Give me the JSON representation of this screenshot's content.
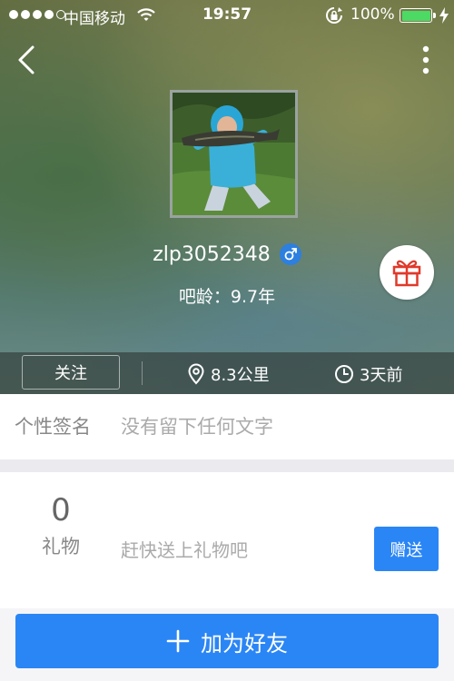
{
  "status_bar": {
    "carrier": "中国移动",
    "time": "19:57",
    "battery": "100%"
  },
  "profile": {
    "username": "zlp3052348",
    "gender_icon": "male-icon",
    "bar_age": "吧龄：9.7年"
  },
  "stats": {
    "follow_label": "关注",
    "distance": "8.3公里",
    "last_seen": "3天前"
  },
  "signature": {
    "label": "个性签名",
    "text": "没有留下任何文字"
  },
  "gifts": {
    "count": "0",
    "label": "礼物",
    "hint": "赶快送上礼物吧",
    "send_label": "赠送"
  },
  "actions": {
    "add_friend_label": "加为好友"
  },
  "colors": {
    "accent_blue": "#2b86f5",
    "gift_red": "#e0392b",
    "battery_green": "#4cd964"
  }
}
